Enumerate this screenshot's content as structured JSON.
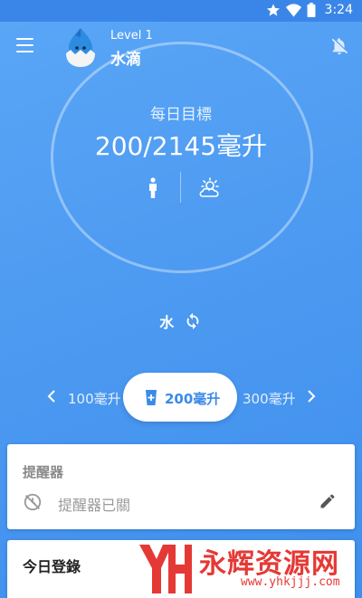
{
  "status_bar": {
    "time": "3:24",
    "icons": [
      "star-icon",
      "wifi-icon",
      "battery-icon"
    ]
  },
  "app_bar": {
    "level": "Level 1",
    "title": "水滴",
    "menu_icon": "menu-icon",
    "bell_icon": "bell-off-icon"
  },
  "progress": {
    "label": "每日目標",
    "value": "200/2145毫升"
  },
  "drink": {
    "type": "水"
  },
  "amounts": {
    "prev": "100毫升",
    "selected": "200毫升",
    "next": "300毫升"
  },
  "reminder": {
    "title": "提醒器",
    "status": "提醒器已關"
  },
  "log": {
    "title": "今日登錄"
  },
  "watermark": {
    "text": "永辉资源网",
    "url": "www.yhkjjj.com"
  },
  "colors": {
    "primary": "#4a98f0",
    "accent": "#3b8ae9",
    "watermark": "#e53935"
  }
}
